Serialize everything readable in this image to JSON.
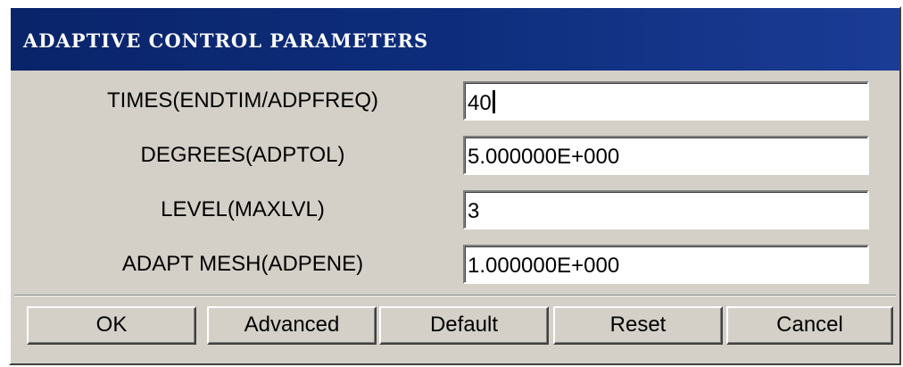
{
  "dialog": {
    "title": "ADAPTIVE CONTROL PARAMETERS"
  },
  "fields": [
    {
      "label": "TIMES(ENDTIM/ADPFREQ)",
      "value": "40"
    },
    {
      "label": "DEGREES(ADPTOL)",
      "value": "5.000000E+000"
    },
    {
      "label": "LEVEL(MAXLVL)",
      "value": "3"
    },
    {
      "label": "ADAPT MESH(ADPENE)",
      "value": "1.000000E+000"
    }
  ],
  "buttons": {
    "ok": "OK",
    "advanced": "Advanced",
    "default": "Default",
    "reset": "Reset",
    "cancel": "Cancel"
  },
  "colors": {
    "titlebar": "#0a246a",
    "dialog_bg": "#d4d0c8",
    "field_bg": "#ffffff"
  }
}
